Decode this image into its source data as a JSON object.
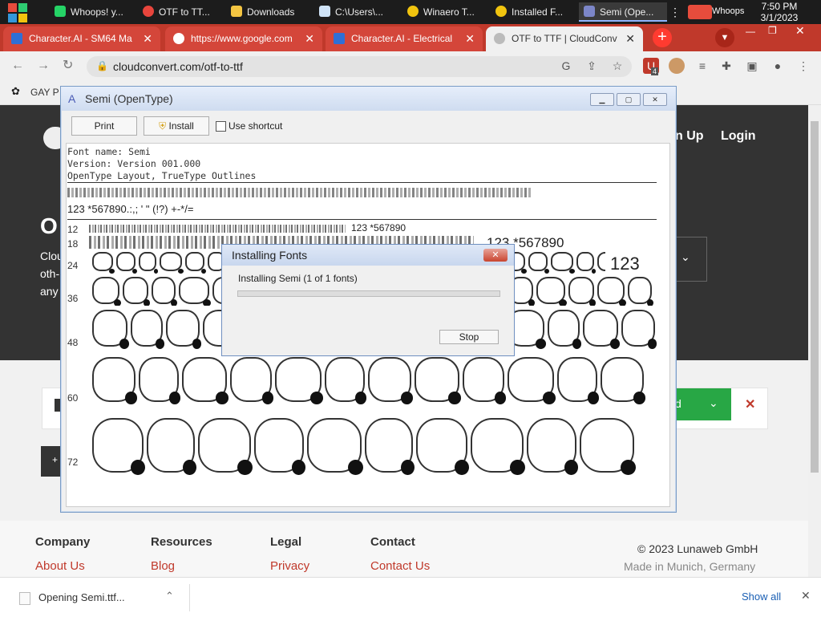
{
  "taskbar": {
    "items": [
      {
        "label": "Whoops! y...",
        "icon": "whatsapp-icon",
        "color": "#25d366"
      },
      {
        "label": "OTF to TT...",
        "icon": "chrome-icon",
        "color": "#e8453c"
      },
      {
        "label": "Downloads",
        "icon": "folder-icon",
        "color": "#f4c542"
      },
      {
        "label": "C:\\Users\\...",
        "icon": "notepad-icon",
        "color": "#cfe3f7"
      },
      {
        "label": "Winaero T...",
        "icon": "winaero-icon",
        "color": "#f1c40f"
      },
      {
        "label": "Installed F...",
        "icon": "font-icon",
        "color": "#f1c40f"
      },
      {
        "label": "Semi (Ope...",
        "icon": "font-viewer-icon",
        "color": "#7c86c8"
      }
    ],
    "tray_label": "Whoops",
    "time": "7:50 PM",
    "date": "3/1/2023"
  },
  "browser": {
    "tabs": [
      {
        "label": "Character.AI - SM64 Ma",
        "icon": "character-ai-icon",
        "active": false
      },
      {
        "label": "https://www.google.com",
        "icon": "google-icon",
        "active": false
      },
      {
        "label": "Character.AI - Electrical",
        "icon": "character-ai-icon",
        "active": false
      },
      {
        "label": "OTF to TTF | CloudConv",
        "icon": "cloudconvert-icon",
        "active": true
      }
    ],
    "url": "cloudconvert.com/otf-to-ttf",
    "extension_badge": "4",
    "bookmark_label": "GAY P"
  },
  "page": {
    "nav": {
      "signup": "n Up",
      "login": "Login"
    },
    "hero_heading_fragment": "O",
    "hero_text_fragments": [
      "Clou",
      "oth-",
      "any"
    ],
    "convert_button_fragment": "d",
    "footer": {
      "columns": [
        {
          "heading": "Company",
          "link": "About Us"
        },
        {
          "heading": "Resources",
          "link": "Blog"
        },
        {
          "heading": "Legal",
          "link": "Privacy"
        },
        {
          "heading": "Contact",
          "link": "Contact Us"
        }
      ],
      "copyright": "© 2023 Lunaweb GmbH",
      "made_in": "Made in Munich, Germany"
    }
  },
  "font_viewer": {
    "title": "Semi (OpenType)",
    "print_label": "Print",
    "install_label": "Install",
    "shortcut_label": "Use shortcut",
    "info_lines": [
      "Font name: Semi",
      "Version: Version 001.000",
      "OpenType Layout, TrueType Outlines"
    ],
    "sample_digits": "123 *567890.:,; ' \" (!?) +-*/=",
    "sizes": [
      "12",
      "18",
      "24",
      "36",
      "48",
      "60",
      "72"
    ],
    "size_12_suffix": "123 *567890",
    "size_18_suffix": "123 *567890",
    "size_24_suffix": "123"
  },
  "install_dialog": {
    "title": "Installing Fonts",
    "message": "Installing Semi (1 of 1 fonts)",
    "stop_label": "Stop",
    "progress": 0.0
  },
  "downloads_bar": {
    "file_label": "Opening Semi.ttf...",
    "show_all": "Show all"
  }
}
